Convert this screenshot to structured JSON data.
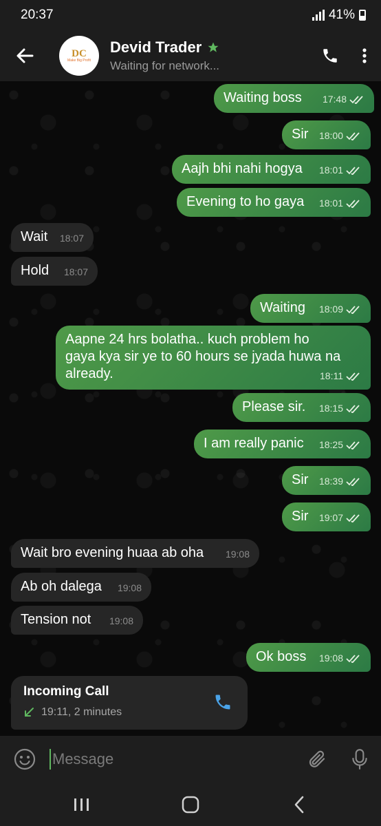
{
  "status_bar": {
    "time": "20:37",
    "battery": "41%"
  },
  "header": {
    "name": "Devid Trader",
    "status": "Waiting for network...",
    "logo_text": "DC",
    "logo_subtext": "Make Big Profit"
  },
  "messages": [
    {
      "dir": "out",
      "text": "Waiting boss",
      "time": "17:48"
    },
    {
      "dir": "out",
      "text": "Sir",
      "time": "18:00"
    },
    {
      "dir": "out",
      "text": "Aajh bhi nahi hogya",
      "time": "18:01"
    },
    {
      "dir": "out",
      "text": "Evening to ho gaya",
      "time": "18:01"
    },
    {
      "dir": "in",
      "text": "Wait",
      "time": "18:07"
    },
    {
      "dir": "in",
      "text": "Hold",
      "time": "18:07"
    },
    {
      "dir": "out",
      "text": "Waiting",
      "time": "18:09"
    },
    {
      "dir": "out",
      "lines": [
        "Aapne 24 hrs bolatha.. kuch problem ho",
        "gaya kya sir ye to 60 hours se jyada huwa na",
        "already."
      ],
      "time": "18:11"
    },
    {
      "dir": "out",
      "text": "Please sir.",
      "time": "18:15"
    },
    {
      "dir": "out",
      "text": "I am really panic",
      "time": "18:25"
    },
    {
      "dir": "out",
      "text": "Sir",
      "time": "18:39"
    },
    {
      "dir": "out",
      "text": "Sir",
      "time": "19:07"
    },
    {
      "dir": "in",
      "text": "Wait bro evening huaa ab oha",
      "time": "19:08"
    },
    {
      "dir": "in",
      "text": "Ab oh dalega",
      "time": "19:08"
    },
    {
      "dir": "in",
      "text": "Tension not",
      "time": "19:08"
    },
    {
      "dir": "out",
      "text": "Ok boss",
      "time": "19:08"
    }
  ],
  "call": {
    "title": "Incoming Call",
    "details": "19:11, 2 minutes"
  },
  "composer": {
    "placeholder": "Message"
  },
  "colors": {
    "accent": "#5fb85f",
    "outgoing_bubble": "#3e8a48",
    "incoming_bubble": "#262626",
    "call_icon": "#4aa3e8"
  }
}
